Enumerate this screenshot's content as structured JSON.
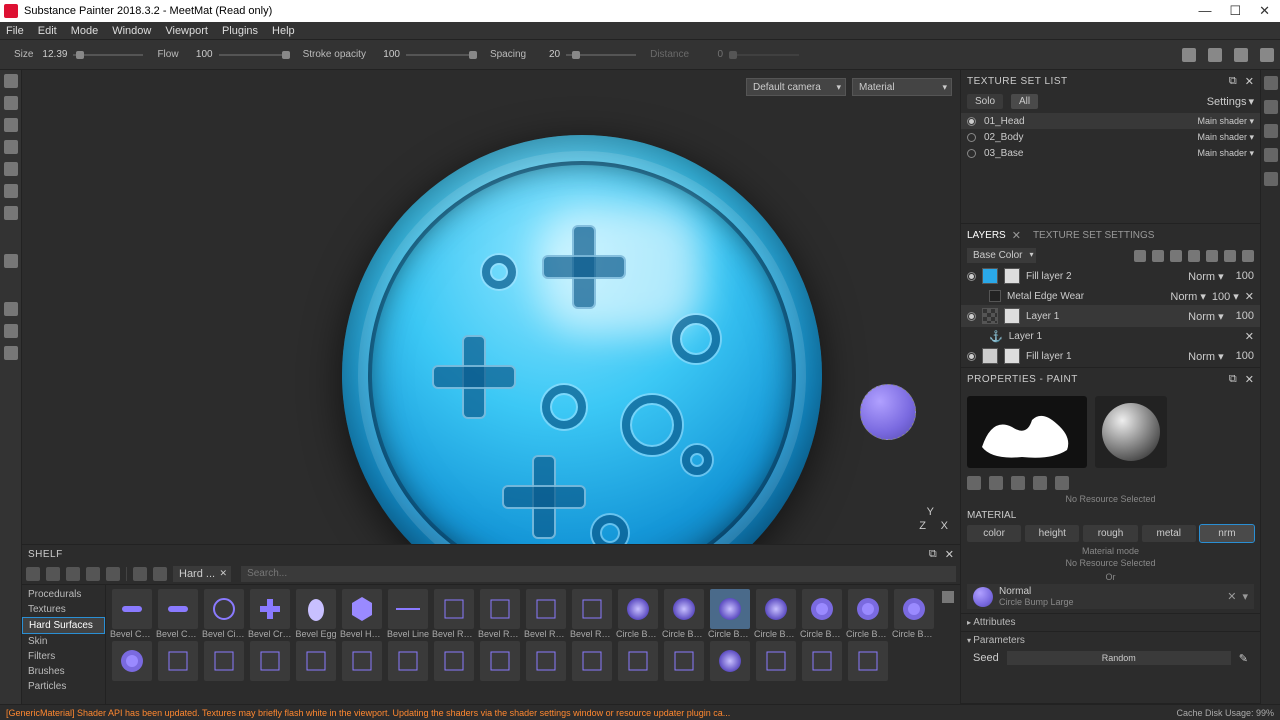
{
  "app": {
    "title": "Substance Painter 2018.3.2 - MeetMat (Read only)"
  },
  "menu": [
    "File",
    "Edit",
    "Mode",
    "Window",
    "Viewport",
    "Plugins",
    "Help"
  ],
  "brush": {
    "size_label": "Size",
    "size": "12.39",
    "flow_label": "Flow",
    "flow": "100",
    "opacity_label": "Stroke opacity",
    "opacity": "100",
    "spacing_label": "Spacing",
    "spacing": "20",
    "distance_label": "Distance",
    "distance": "0"
  },
  "viewport": {
    "camera": "Default camera",
    "mode": "Material"
  },
  "texture_set": {
    "title": "TEXTURE SET LIST",
    "solo": "Solo",
    "all": "All",
    "settings": "Settings",
    "items": [
      {
        "name": "01_Head",
        "shader": "Main shader",
        "active": true
      },
      {
        "name": "02_Body",
        "shader": "Main shader",
        "active": false
      },
      {
        "name": "03_Base",
        "shader": "Main shader",
        "active": false
      }
    ]
  },
  "layers": {
    "tab1": "LAYERS",
    "tab2": "TEXTURE SET SETTINGS",
    "channel": "Base Color",
    "items": [
      {
        "name": "Fill layer 2",
        "blend": "Norm",
        "op": "100",
        "color": "#2aa8e8",
        "effects": [
          {
            "name": "Metal Edge Wear",
            "blend": "Norm",
            "op": "100"
          }
        ]
      },
      {
        "name": "Layer 1",
        "blend": "Norm",
        "op": "100",
        "selected": true,
        "sub": [
          {
            "name": "Layer 1"
          }
        ]
      },
      {
        "name": "Fill layer 1",
        "blend": "Norm",
        "op": "100",
        "color": "#cccccc"
      }
    ]
  },
  "properties": {
    "title": "PROPERTIES - PAINT",
    "no_resource": "No Resource Selected",
    "material": "MATERIAL",
    "channels": [
      "color",
      "height",
      "rough",
      "metal",
      "nrm"
    ],
    "active_channel": 4,
    "mat_mode": "Material mode",
    "or": "Or",
    "normal": {
      "label": "Normal",
      "sub": "Circle Bump Large"
    },
    "attributes": "Attributes",
    "parameters": "Parameters",
    "seed_label": "Seed",
    "random": "Random"
  },
  "shelf": {
    "title": "SHELF",
    "chip": "Hard ...",
    "search_placeholder": "Search...",
    "cats": [
      "Procedurals",
      "Textures",
      "Hard Surfaces",
      "Skin",
      "Filters",
      "Brushes",
      "Particles"
    ],
    "cat_sel": 2,
    "items_row1": [
      "Bevel Capsule",
      "Bevel Caps...",
      "Bevel Circle",
      "Bevel Cross",
      "Bevel Egg",
      "Bevel Hexa...",
      "Bevel Line",
      "Bevel Recta...",
      "Bevel Recta...",
      "Bevel Recta...",
      "Bevel Recta...",
      "Circle Bump",
      "Circle Bum...",
      "Circle Bum...",
      "Circle Bum...",
      "Circle Button",
      "Circle Butto...",
      "Circle Butto..."
    ],
    "sel_item": 13
  },
  "status": {
    "error": "[GenericMaterial] Shader API has been updated. Textures may briefly flash white in the viewport. Updating the shaders via the shader settings window or resource updater plugin ca...",
    "cache": "Cache Disk Usage:    99%"
  }
}
